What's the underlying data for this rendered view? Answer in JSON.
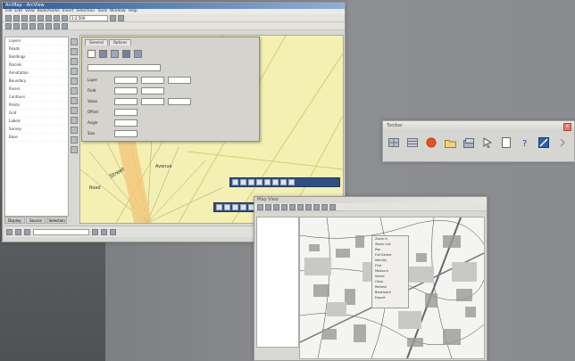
{
  "window_main": {
    "title": "ArcMap - ArcView",
    "menu": [
      "File",
      "Edit",
      "View",
      "Bookmarks",
      "Insert",
      "Selection",
      "Tools",
      "Window",
      "Help"
    ],
    "scale": "1:2,500",
    "toc_items": [
      "Layers",
      "Roads",
      "Buildings",
      "Parcels",
      "Annotation",
      "Boundary",
      "Rivers",
      "Contours",
      "Points",
      "Grid",
      "Labels",
      "Survey",
      "Base"
    ],
    "toc_tabs": [
      "Display",
      "Source",
      "Selection"
    ],
    "dialog": {
      "tabs": [
        "General",
        "Options"
      ],
      "row_labels": [
        "Layer",
        "Field",
        "Value",
        "Offset",
        "Angle",
        "Size"
      ]
    },
    "map_labels": [
      "Street",
      "Avenue",
      "Road"
    ]
  },
  "toolbar_window": {
    "title": "Toolbar",
    "close": "×",
    "tools": [
      "grid-icon",
      "table-icon",
      "record-icon",
      "folder-icon",
      "layers-icon",
      "cursor-icon",
      "page-icon",
      "help-icon",
      "edit-icon",
      "arrow-icon"
    ]
  },
  "window_secondary": {
    "title": "Map View",
    "menu_items": [
      "Zoom In",
      "Zoom Out",
      "Pan",
      "Full Extent",
      "Identify",
      "Find",
      "Measure",
      "Select",
      "Clear",
      "Refresh",
      "Bookmark",
      "Export"
    ]
  }
}
